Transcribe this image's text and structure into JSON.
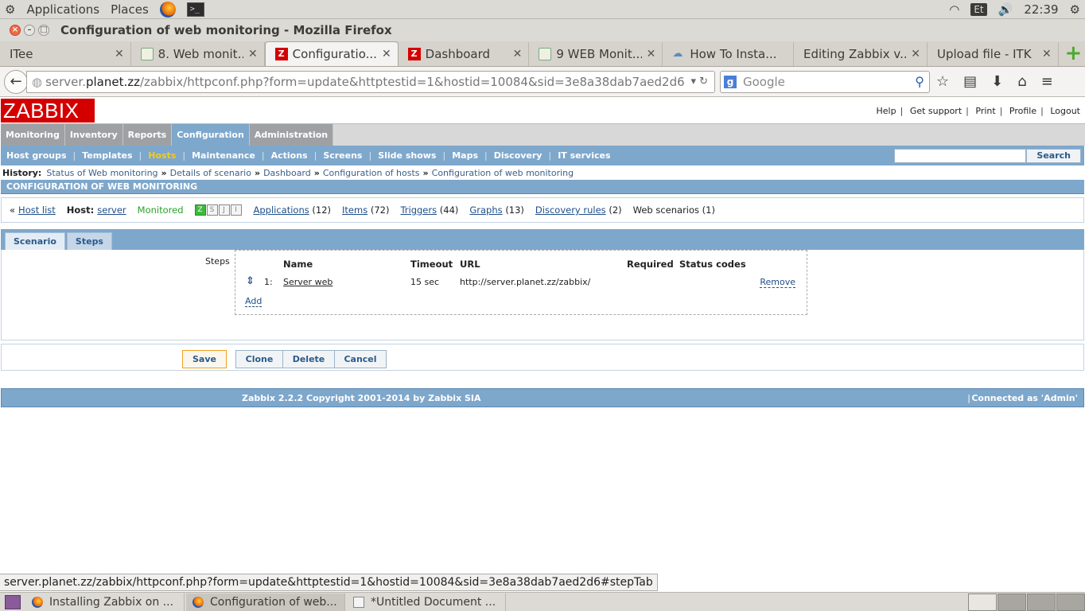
{
  "os_panel": {
    "applications": "Applications",
    "places": "Places",
    "keyboard": "Et",
    "clock": "22:39"
  },
  "window": {
    "title": "Configuration of web monitoring - Mozilla Firefox"
  },
  "tabs": [
    {
      "label": "ITee",
      "icon": "none"
    },
    {
      "label": "8. Web monit...",
      "icon": "generic-page-icon"
    },
    {
      "label": "Configuratio...",
      "icon": "zabbix-icon",
      "active": true
    },
    {
      "label": "Dashboard",
      "icon": "zabbix-icon"
    },
    {
      "label": "9 WEB Monit...",
      "icon": "generic-page-icon"
    },
    {
      "label": "How To Insta...",
      "icon": "cloud-icon"
    },
    {
      "label": "Editing Zabbix v...",
      "icon": "none"
    },
    {
      "label": "Upload file - ITK",
      "icon": "none"
    }
  ],
  "address_bar": {
    "url_prefix": "server.",
    "url_host": "planet.zz",
    "url_path": "/zabbix/httpconf.php?form=update&httptestid=1&hostid=10084&sid=3e8a38dab7aed2d6",
    "search_placeholder": "Google"
  },
  "zabbix": {
    "logo": "ZABBIX",
    "top_links": [
      "Help",
      "Get support",
      "Print",
      "Profile",
      "Logout"
    ],
    "main_menu": [
      "Monitoring",
      "Inventory",
      "Reports",
      "Configuration",
      "Administration"
    ],
    "sub_menu": [
      "Host groups",
      "Templates",
      "Hosts",
      "Maintenance",
      "Actions",
      "Screens",
      "Slide shows",
      "Maps",
      "Discovery",
      "IT services"
    ],
    "search_button": "Search",
    "history_label": "History:",
    "history": [
      "Status of Web monitoring",
      "Details of scenario",
      "Dashboard",
      "Configuration of hosts",
      "Configuration of web monitoring"
    ],
    "section_title": "CONFIGURATION OF WEB MONITORING",
    "host_nav": {
      "host_list": "Host list",
      "host_label": "Host:",
      "host_name": "server",
      "status": "Monitored",
      "applications": "Applications",
      "applications_count": "(12)",
      "items": "Items",
      "items_count": "(72)",
      "triggers": "Triggers",
      "triggers_count": "(44)",
      "graphs": "Graphs",
      "graphs_count": "(13)",
      "discovery": "Discovery rules",
      "discovery_count": "(2)",
      "web": "Web scenarios (1)"
    },
    "form_tabs": [
      "Scenario",
      "Steps"
    ],
    "steps": {
      "label": "Steps",
      "columns": [
        "Name",
        "Timeout",
        "URL",
        "Required",
        "Status codes"
      ],
      "rows": [
        {
          "num": "1:",
          "name": "Server web",
          "timeout": "15 sec",
          "url": "http://server.planet.zz/zabbix/",
          "required": "",
          "status_codes": "",
          "remove": "Remove"
        }
      ],
      "add": "Add"
    },
    "buttons": [
      "Save",
      "Clone",
      "Delete",
      "Cancel"
    ],
    "footer": {
      "copyright": "Zabbix 2.2.2 Copyright 2001-2014 by Zabbix SIA",
      "connected": "Connected as 'Admin'"
    }
  },
  "status_url": "server.planet.zz/zabbix/httpconf.php?form=update&httptestid=1&hostid=10084&sid=3e8a38dab7aed2d6#stepTab",
  "taskbar": [
    {
      "label": "Installing Zabbix on ...",
      "icon": "firefox-icon"
    },
    {
      "label": "Configuration of web...",
      "icon": "firefox-icon",
      "active": true
    },
    {
      "label": "*Untitled Document ...",
      "icon": "text-editor-icon"
    }
  ]
}
